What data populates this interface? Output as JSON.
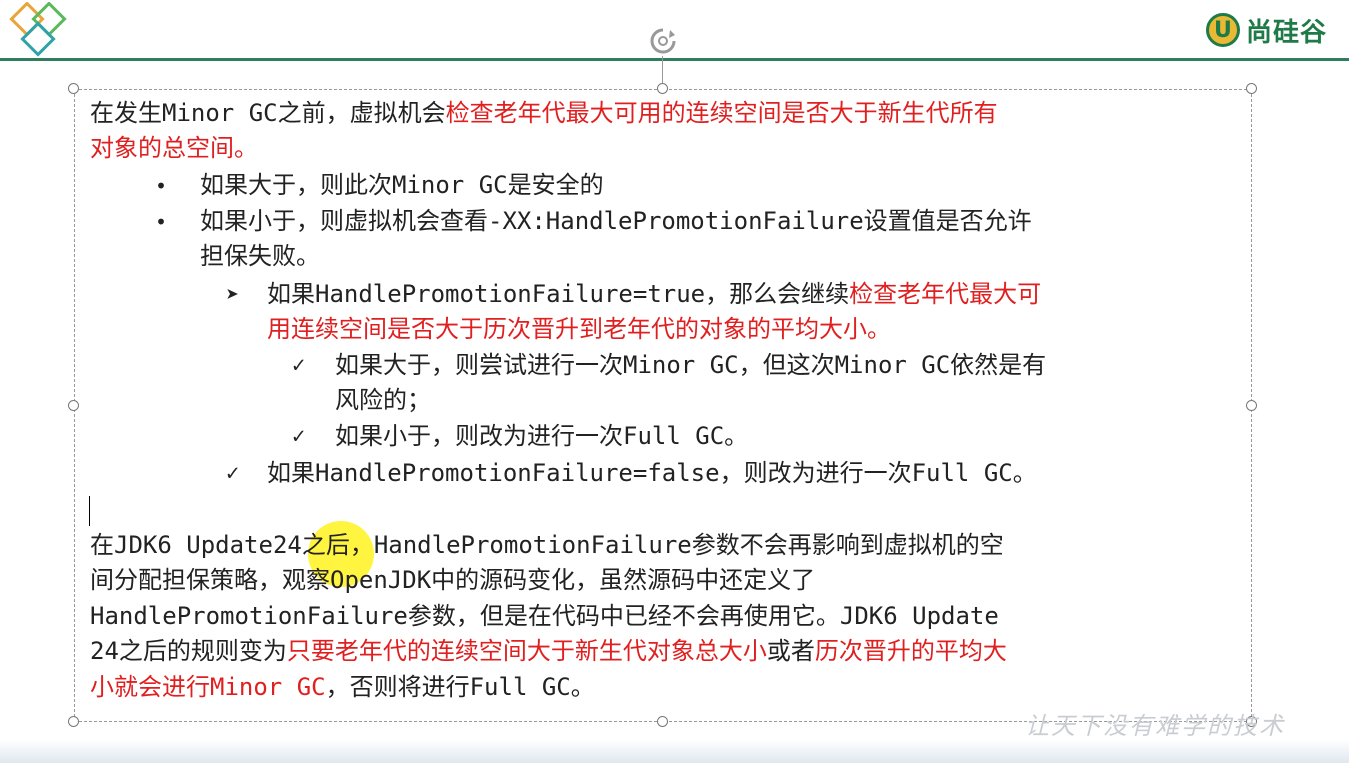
{
  "brand": {
    "logo_letter": "U",
    "name": "尚硅谷"
  },
  "slide": {
    "intro": [
      {
        "text": "在发生Minor GC之前，虚拟机会",
        "color": "black"
      },
      {
        "text": "检查老年代最大可用的连续空间是否大于新生代所有",
        "color": "red"
      }
    ],
    "intro_line2": {
      "text": "对象的总空间。",
      "color": "red"
    },
    "bullet1": "如果大于，则此次Minor GC是安全的",
    "bullet2_line1": "如果小于，则虚拟机会查看-XX:HandlePromotionFailure设置值是否允许",
    "bullet2_line2": "担保失败。",
    "arrow_line1_black": "如果HandlePromotionFailure=true，那么会继续",
    "arrow_line1_red": "检查老年代最大可",
    "arrow_line2_red": "用连续空间是否大于历次晋升到老年代的对象的平均大小。",
    "check1_line1": "如果大于，则尝试进行一次Minor GC，但这次Minor GC依然是有",
    "check1_line2": "风险的；",
    "check2": "如果小于，则改为进行一次Full GC。",
    "check3": "如果HandlePromotionFailure=false，则改为进行一次Full GC。",
    "para2_line1": "在JDK6 Update24之后，HandlePromotionFailure参数不会再影响到虚拟机的空",
    "para2_line2": "间分配担保策略，观察OpenJDK中的源码变化，虽然源码中还定义了",
    "para2_line3": "HandlePromotionFailure参数，但是在代码中已经不会再使用它。JDK6 Update",
    "para2_line4_a": "24之后的规则变为",
    "para2_line4_b": "只要老年代的连续空间大于新生代对象总大小",
    "para2_line4_c": "或者",
    "para2_line4_d": "历次晋升的平均大",
    "para2_line5_a": "小就会进行Minor GC",
    "para2_line5_b": "，否则将进行Full GC。",
    "bullet_dot": "•",
    "arrow_marker": "➤",
    "check_marker": "✓"
  },
  "watermark": "让天下没有难学的技术",
  "colors": {
    "accent": "#2f7d5e",
    "emphasis": "#e02020"
  }
}
